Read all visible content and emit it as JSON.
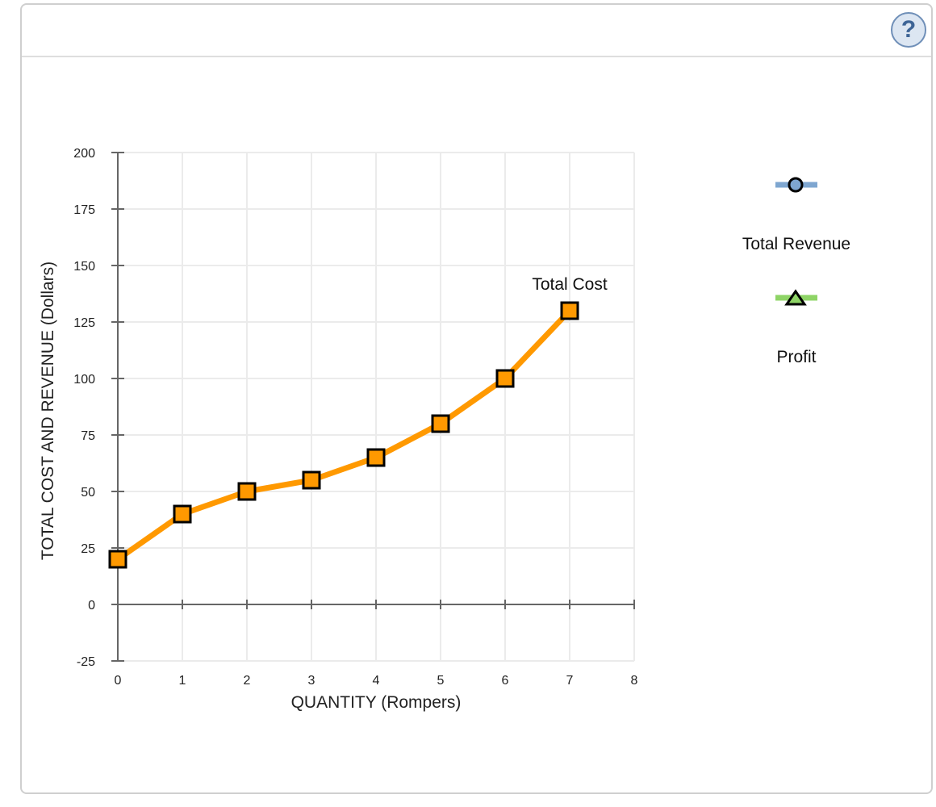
{
  "header": {
    "help_icon": "question-mark",
    "help_glyph": "?"
  },
  "chart_data": {
    "type": "line",
    "xlabel": "QUANTITY (Rompers)",
    "ylabel": "TOTAL COST AND REVENUE (Dollars)",
    "xlim": [
      0,
      8
    ],
    "ylim": [
      -25,
      200
    ],
    "x_ticks": [
      0,
      1,
      2,
      3,
      4,
      5,
      6,
      7,
      8
    ],
    "y_ticks": [
      -25,
      0,
      25,
      50,
      75,
      100,
      125,
      150,
      175,
      200
    ],
    "grid": true,
    "series": [
      {
        "name": "Total Cost",
        "color": "#ff9900",
        "marker": "square",
        "x": [
          0,
          1,
          2,
          3,
          4,
          5,
          6,
          7
        ],
        "values": [
          20,
          40,
          50,
          55,
          65,
          80,
          100,
          130
        ],
        "label": "Total Cost"
      }
    ],
    "legend": {
      "placement": "right",
      "items": [
        {
          "name": "Total Revenue",
          "color": "#7ea6d0",
          "marker": "circle"
        },
        {
          "name": "Profit",
          "color": "#8ed466",
          "marker": "triangle"
        }
      ]
    }
  }
}
